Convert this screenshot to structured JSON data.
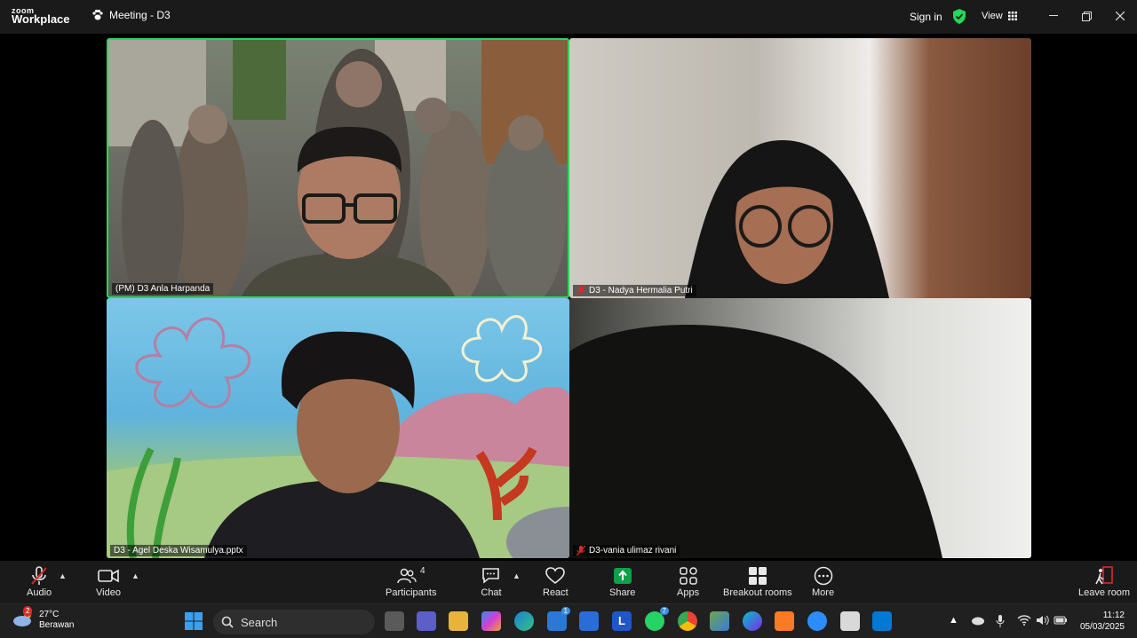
{
  "app": {
    "logo_top": "zoom",
    "logo_bottom": "Workplace",
    "meeting_title": "Meeting - D3",
    "signin": "Sign in",
    "view": "View"
  },
  "participants": [
    {
      "name": "(PM) D3 Anla Harpanda",
      "muted": false,
      "active_speaker": true
    },
    {
      "name": "D3 - Nadya Hermalia Putri",
      "muted": true,
      "active_speaker": false
    },
    {
      "name": "D3 - Agel Deska Wisamulya.pptx",
      "muted": false,
      "active_speaker": false
    },
    {
      "name": "D3-vania ulimaz rivani",
      "muted": true,
      "active_speaker": false
    }
  ],
  "toolbar": {
    "audio": "Audio",
    "video": "Video",
    "participants": "Participants",
    "participants_count": "4",
    "chat": "Chat",
    "react": "React",
    "share": "Share",
    "apps": "Apps",
    "apps_badge": "",
    "breakout": "Breakout rooms",
    "more": "More",
    "leave": "Leave room"
  },
  "taskbar": {
    "weather_temp": "27°C",
    "weather_desc": "Berawan",
    "weather_badge": "2",
    "search": "Search",
    "clock_time": "11:12",
    "clock_date": "05/03/2025",
    "badge_store": "1",
    "badge_whatsapp": "7"
  },
  "colors": {
    "accent_green": "#23d959",
    "share_green": "#0e9f4a",
    "mute_red": "#e02828",
    "bg": "#1a1a1a"
  }
}
